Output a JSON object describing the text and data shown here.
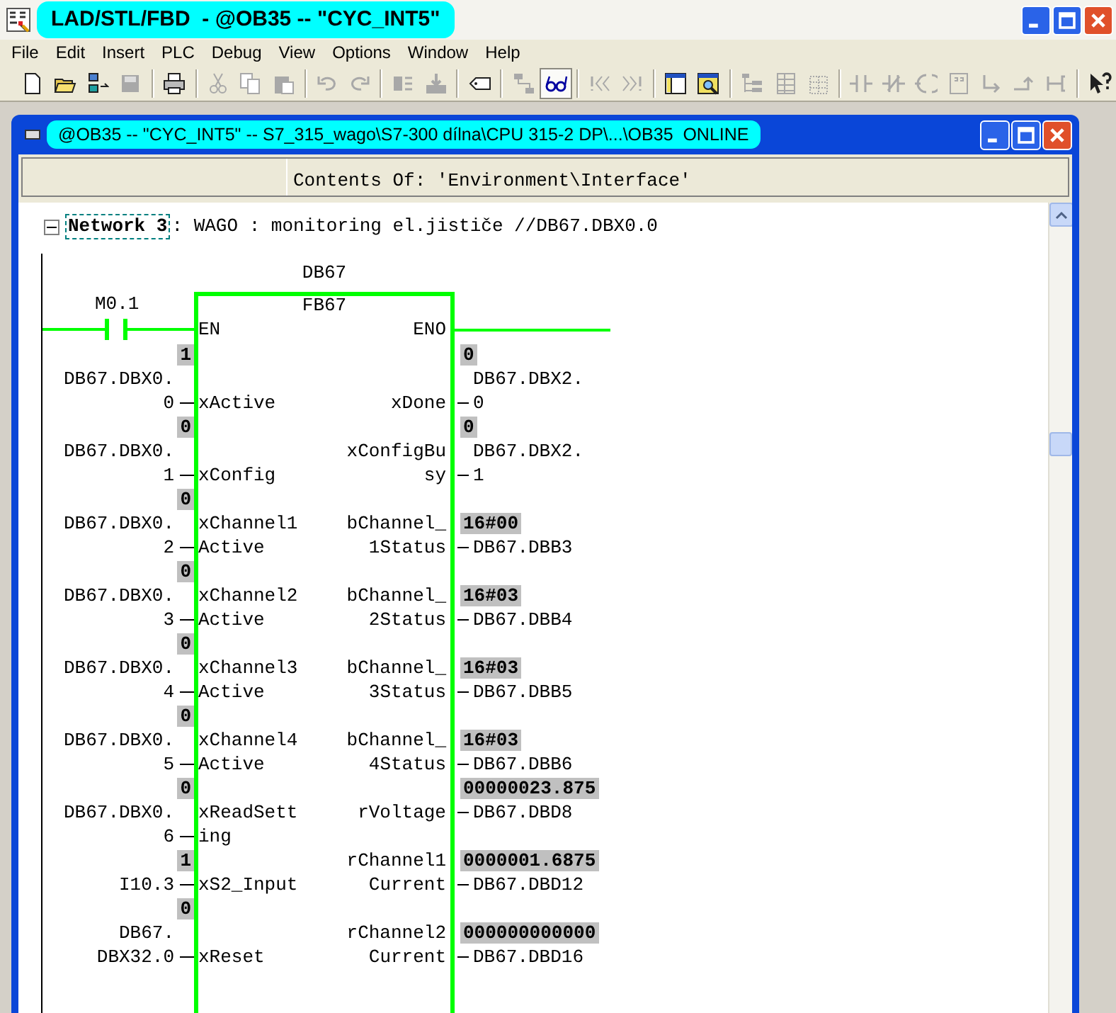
{
  "app_window": {
    "title": "LAD/STL/FBD  - @OB35 -- \"CYC_INT5\""
  },
  "menu": [
    "File",
    "Edit",
    "Insert",
    "PLC",
    "Debug",
    "View",
    "Options",
    "Window",
    "Help"
  ],
  "toolbar": [
    {
      "disabled": false,
      "selected": false
    },
    {
      "disabled": false,
      "selected": false
    },
    {
      "disabled": false,
      "selected": false
    },
    {
      "disabled": true,
      "selected": false
    },
    {
      "disabled": false,
      "selected": false
    },
    {
      "disabled": true,
      "selected": false
    },
    {
      "disabled": true,
      "selected": false
    },
    {
      "disabled": true,
      "selected": false
    },
    {
      "disabled": true,
      "selected": false
    },
    {
      "disabled": true,
      "selected": false
    },
    {
      "disabled": true,
      "selected": false
    },
    {
      "disabled": true,
      "selected": false
    },
    {
      "disabled": false,
      "selected": false
    },
    {
      "disabled": true,
      "selected": false
    },
    {
      "disabled": false,
      "selected": true
    },
    {
      "disabled": true,
      "selected": false
    },
    {
      "disabled": true,
      "selected": false
    },
    {
      "disabled": false,
      "selected": false
    },
    {
      "disabled": false,
      "selected": false
    },
    {
      "disabled": true,
      "selected": false
    },
    {
      "disabled": true,
      "selected": false
    },
    {
      "disabled": true,
      "selected": false
    },
    {
      "disabled": true,
      "selected": false
    },
    {
      "disabled": true,
      "selected": false
    },
    {
      "disabled": true,
      "selected": false
    },
    {
      "disabled": true,
      "selected": false
    },
    {
      "disabled": true,
      "selected": false
    },
    {
      "disabled": true,
      "selected": false
    },
    {
      "disabled": true,
      "selected": false
    },
    {
      "disabled": false,
      "selected": false
    }
  ],
  "editor_window": {
    "title": "@OB35 -- \"CYC_INT5\" -- S7_315_wago\\S7-300 dílna\\CPU 315-2 DP\\...\\OB35  ONLINE",
    "header": "Contents Of: 'Environment\\Interface'"
  },
  "network": {
    "expanded": true,
    "label": "Network 3",
    "comment": ": WAGO : monitoring el.jističe //DB67.DBX0.0"
  },
  "block": {
    "instance": "DB67",
    "type": "FB67",
    "en": "EN",
    "eno": "ENO",
    "powered": true,
    "contact": "M0.1",
    "left_lines": [
      {
        "kind": "value",
        "text": "1"
      },
      {
        "kind": "text",
        "text": "DB67.DBX0."
      },
      {
        "kind": "pin",
        "text": "0"
      },
      {
        "kind": "value",
        "text": "0"
      },
      {
        "kind": "text",
        "text": "DB67.DBX0."
      },
      {
        "kind": "pin",
        "text": "1"
      },
      {
        "kind": "value",
        "text": "0"
      },
      {
        "kind": "text",
        "text": "DB67.DBX0."
      },
      {
        "kind": "pin",
        "text": "2"
      },
      {
        "kind": "value",
        "text": "0"
      },
      {
        "kind": "text",
        "text": "DB67.DBX0."
      },
      {
        "kind": "pin",
        "text": "3"
      },
      {
        "kind": "value",
        "text": "0"
      },
      {
        "kind": "text",
        "text": "DB67.DBX0."
      },
      {
        "kind": "pin",
        "text": "4"
      },
      {
        "kind": "value",
        "text": "0"
      },
      {
        "kind": "text",
        "text": "DB67.DBX0."
      },
      {
        "kind": "pin",
        "text": "5"
      },
      {
        "kind": "value",
        "text": "0"
      },
      {
        "kind": "text",
        "text": "DB67.DBX0."
      },
      {
        "kind": "pin",
        "text": "6"
      },
      {
        "kind": "value",
        "text": "1"
      },
      {
        "kind": "pin",
        "text": "I10.3"
      },
      {
        "kind": "value",
        "text": "0"
      },
      {
        "kind": "text",
        "text": "DB67."
      },
      {
        "kind": "pin",
        "text": "DBX32.0"
      }
    ],
    "in_lines": [
      {
        "kind": "blank"
      },
      {
        "kind": "blank"
      },
      {
        "kind": "text",
        "text": "xActive"
      },
      {
        "kind": "blank"
      },
      {
        "kind": "blank"
      },
      {
        "kind": "text",
        "text": "xConfig"
      },
      {
        "kind": "blank"
      },
      {
        "kind": "text",
        "text": "xChannel1"
      },
      {
        "kind": "text",
        "text": "Active"
      },
      {
        "kind": "blank"
      },
      {
        "kind": "text",
        "text": "xChannel2"
      },
      {
        "kind": "text",
        "text": "Active"
      },
      {
        "kind": "blank"
      },
      {
        "kind": "text",
        "text": "xChannel3"
      },
      {
        "kind": "text",
        "text": "Active"
      },
      {
        "kind": "blank"
      },
      {
        "kind": "text",
        "text": "xChannel4"
      },
      {
        "kind": "text",
        "text": "Active"
      },
      {
        "kind": "blank"
      },
      {
        "kind": "text",
        "text": "xReadSett"
      },
      {
        "kind": "text",
        "text": "ing"
      },
      {
        "kind": "blank"
      },
      {
        "kind": "text",
        "text": "xS2_Input"
      },
      {
        "kind": "blank"
      },
      {
        "kind": "blank"
      },
      {
        "kind": "text",
        "text": "xReset"
      }
    ],
    "out_lines": [
      {
        "kind": "blank"
      },
      {
        "kind": "blank"
      },
      {
        "kind": "text",
        "text": "xDone"
      },
      {
        "kind": "blank"
      },
      {
        "kind": "text",
        "text": "xConfigBu"
      },
      {
        "kind": "text",
        "text": "sy"
      },
      {
        "kind": "blank"
      },
      {
        "kind": "text",
        "text": "bChannel_"
      },
      {
        "kind": "text",
        "text": "1Status"
      },
      {
        "kind": "blank"
      },
      {
        "kind": "text",
        "text": "bChannel_"
      },
      {
        "kind": "text",
        "text": "2Status"
      },
      {
        "kind": "blank"
      },
      {
        "kind": "text",
        "text": "bChannel_"
      },
      {
        "kind": "text",
        "text": "3Status"
      },
      {
        "kind": "blank"
      },
      {
        "kind": "text",
        "text": "bChannel_"
      },
      {
        "kind": "text",
        "text": "4Status"
      },
      {
        "kind": "blank"
      },
      {
        "kind": "text",
        "text": "rVoltage"
      },
      {
        "kind": "blank"
      },
      {
        "kind": "text",
        "text": "rChannel1"
      },
      {
        "kind": "text",
        "text": "Current"
      },
      {
        "kind": "blank"
      },
      {
        "kind": "text",
        "text": "rChannel2"
      },
      {
        "kind": "text",
        "text": "Current"
      }
    ],
    "right_lines": [
      {
        "kind": "value",
        "text": "0"
      },
      {
        "kind": "text",
        "text": "DB67.DBX2."
      },
      {
        "kind": "pin",
        "text": "0"
      },
      {
        "kind": "value",
        "text": "0"
      },
      {
        "kind": "text",
        "text": "DB67.DBX2."
      },
      {
        "kind": "pin",
        "text": "1"
      },
      {
        "kind": "blank"
      },
      {
        "kind": "value",
        "text": "16#00"
      },
      {
        "kind": "pin",
        "text": "DB67.DBB3"
      },
      {
        "kind": "blank"
      },
      {
        "kind": "value",
        "text": "16#03"
      },
      {
        "kind": "pin",
        "text": "DB67.DBB4"
      },
      {
        "kind": "blank"
      },
      {
        "kind": "value",
        "text": "16#03"
      },
      {
        "kind": "pin",
        "text": "DB67.DBB5"
      },
      {
        "kind": "blank"
      },
      {
        "kind": "value",
        "text": "16#03"
      },
      {
        "kind": "pin",
        "text": "DB67.DBB6"
      },
      {
        "kind": "value",
        "text": "00000023.875"
      },
      {
        "kind": "pin",
        "text": "DB67.DBD8"
      },
      {
        "kind": "blank"
      },
      {
        "kind": "value",
        "text": "0000001.6875"
      },
      {
        "kind": "pin",
        "text": "DB67.DBD12"
      },
      {
        "kind": "blank"
      },
      {
        "kind": "value",
        "text": "000000000000"
      },
      {
        "kind": "pin",
        "text": "DB67.DBD16"
      }
    ]
  }
}
